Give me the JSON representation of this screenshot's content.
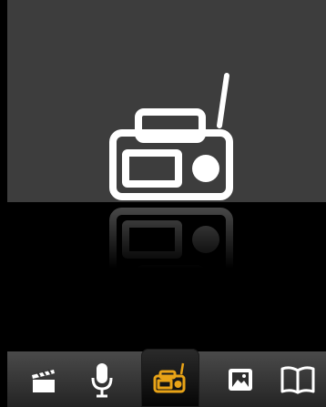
{
  "screen": {
    "current_app_icon": "radio-icon",
    "colors": {
      "top_background": "#3d3d3d",
      "bottom_background": "#000000",
      "icon_white": "#ffffff",
      "accent_selected": "#e8a317"
    }
  },
  "dock": {
    "items": [
      {
        "name": "clapperboard-icon",
        "selected": false
      },
      {
        "name": "microphone-icon",
        "selected": false
      },
      {
        "name": "radio-icon",
        "selected": true
      },
      {
        "name": "photo-icon",
        "selected": false
      },
      {
        "name": "book-icon",
        "selected": false
      }
    ]
  }
}
